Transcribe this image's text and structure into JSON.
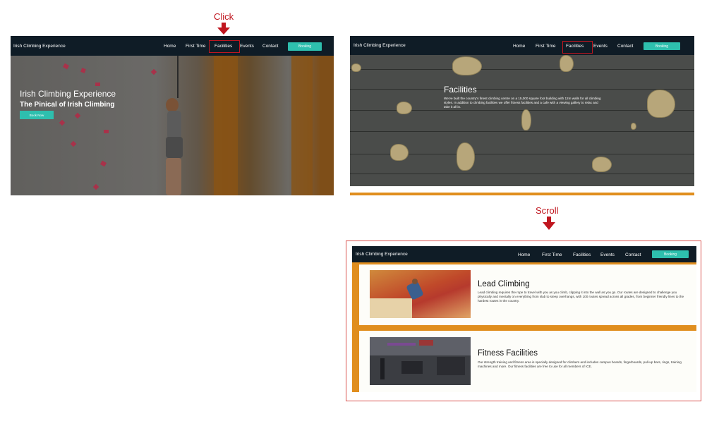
{
  "annotations": {
    "click_label": "Click",
    "scroll_label": "Scroll",
    "arrow_color": "#c0161f"
  },
  "nav": {
    "brand": "Irish Climbing Experience",
    "items": [
      "Home",
      "First Time",
      "Facilities",
      "Events",
      "Contact"
    ],
    "button_label": "Booking"
  },
  "hero": {
    "title": "Irish Climbing Experience",
    "subtitle": "The Pinical of Irish Climbing",
    "button_label": "Book Now"
  },
  "facilities": {
    "title": "Facilities",
    "body": "We've built the country's finest climbing centre on a 15,000 square foot building with 12m walls for all climbing styles. In addition to climbing facilities we offer fitness facilities and a cafe with a viewing gallery to relax and take it all in."
  },
  "cards": [
    {
      "title": "Lead Climbing",
      "body": "Lead climbing requires the rope to travel with you as you climb, clipping it into the wall as you go. Our routes are designed to challenge you physically and mentally on everything from slab to steep overhangs, with 100 routes spread across all grades, from beginner friendly lines to the hardest routes in the country."
    },
    {
      "title": "Fitness Facilities",
      "body": "Our strength training and fitness area is specially designed for climbers and includes campus boards, fingerboards, pull-up bars, rings, training machines and more. Our fitness facilities are free to use for all members of ICE."
    }
  ],
  "colors": {
    "navbar": "#0f1c26",
    "accent_teal": "#2ebfae",
    "accent_orange": "#e08e1e"
  },
  "icons": {
    "click_arrow": "arrow-down-icon",
    "scroll_arrow": "arrow-down-icon"
  }
}
